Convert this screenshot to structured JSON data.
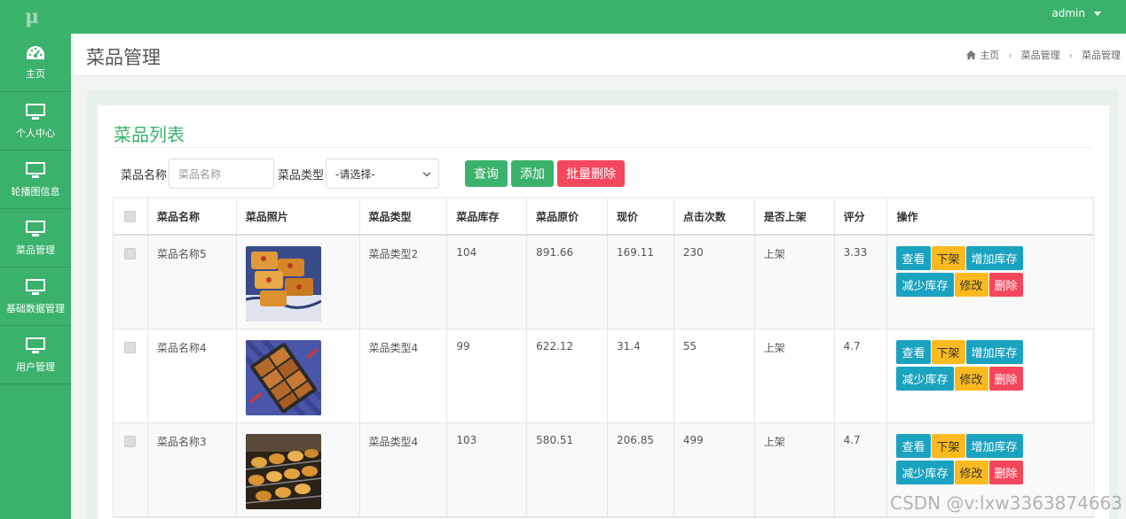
{
  "topbar": {
    "logo": "μ",
    "user": "admin"
  },
  "sidebar": {
    "items": [
      {
        "label": "主页",
        "icon": "dashboard-icon"
      },
      {
        "label": "个人中心",
        "icon": "monitor-icon"
      },
      {
        "label": "轮播图信息",
        "icon": "monitor-icon"
      },
      {
        "label": "菜品管理",
        "icon": "monitor-icon"
      },
      {
        "label": "基础数据管理",
        "icon": "monitor-icon"
      },
      {
        "label": "用户管理",
        "icon": "monitor-icon"
      }
    ]
  },
  "header": {
    "title": "菜品管理",
    "breadcrumb": {
      "home": "主页",
      "level1": "菜品管理",
      "level2": "菜品管理"
    }
  },
  "card": {
    "title": "菜品列表",
    "search": {
      "name_label": "菜品名称",
      "name_placeholder": "菜品名称",
      "type_label": "菜品类型",
      "type_selected": "-请选择-",
      "query_label": "查询",
      "add_label": "添加",
      "batch_delete_label": "批量删除"
    },
    "table": {
      "headers": [
        "菜品名称",
        "菜品照片",
        "菜品类型",
        "菜品库存",
        "菜品原价",
        "现价",
        "点击次数",
        "是否上架",
        "评分",
        "操作"
      ],
      "actions": {
        "view": "查看",
        "offshelf": "下架",
        "add_stock": "增加库存",
        "reduce_stock": "减少库存",
        "edit": "修改",
        "delete": "删除"
      },
      "rows": [
        {
          "name": "菜品名称5",
          "type": "菜品类型2",
          "stock": "104",
          "orig_price": "891.66",
          "price": "169.11",
          "clicks": "230",
          "onshelf": "上架",
          "rating": "3.33"
        },
        {
          "name": "菜品名称4",
          "type": "菜品类型4",
          "stock": "99",
          "orig_price": "622.12",
          "price": "31.4",
          "clicks": "55",
          "onshelf": "上架",
          "rating": "4.7"
        },
        {
          "name": "菜品名称3",
          "type": "菜品类型4",
          "stock": "103",
          "orig_price": "580.51",
          "price": "206.85",
          "clicks": "499",
          "onshelf": "上架",
          "rating": "4.7"
        }
      ]
    }
  },
  "watermark": "CSDN @v:lxw3363874663",
  "colors": {
    "primary": "#3bb26b",
    "info": "#1aa3c1",
    "warning": "#fdba1f",
    "danger": "#f5475b"
  }
}
